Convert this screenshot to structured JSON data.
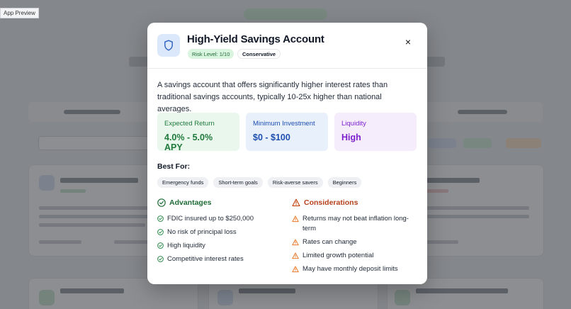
{
  "app": {
    "preview_label": "App Preview"
  },
  "modal": {
    "title": "High-Yield Savings Account",
    "risk_badge": "Risk Level: 1/10",
    "category_badge": "Conservative",
    "close_symbol": "×",
    "description": "A savings account that offers significantly higher interest rates than traditional savings accounts, typically 10-25x higher than national averages.",
    "stats": [
      {
        "label": "Expected Return",
        "value": "4.0% - 5.0% APY"
      },
      {
        "label": "Minimum Investment",
        "value": "$0 - $100"
      },
      {
        "label": "Liquidity",
        "value": "High"
      }
    ],
    "best_for": {
      "title": "Best For:",
      "tags": [
        "Emergency funds",
        "Short-term goals",
        "Risk-averse savers",
        "Beginners"
      ]
    },
    "advantages": {
      "title": "Advantages",
      "items": [
        "FDIC insured up to $250,000",
        "No risk of principal loss",
        "High liquidity",
        "Competitive interest rates"
      ]
    },
    "considerations": {
      "title": "Considerations",
      "items": [
        "Returns may not beat inflation long-term",
        "Rates can change",
        "Limited growth potential",
        "May have monthly deposit limits"
      ]
    }
  },
  "colors": {
    "advantage": "#1f6b37",
    "consideration": "#b5401a",
    "accent_blue": "#1e4fb0",
    "accent_purple": "#7e22ce",
    "accent_green": "#1f7a3c"
  }
}
